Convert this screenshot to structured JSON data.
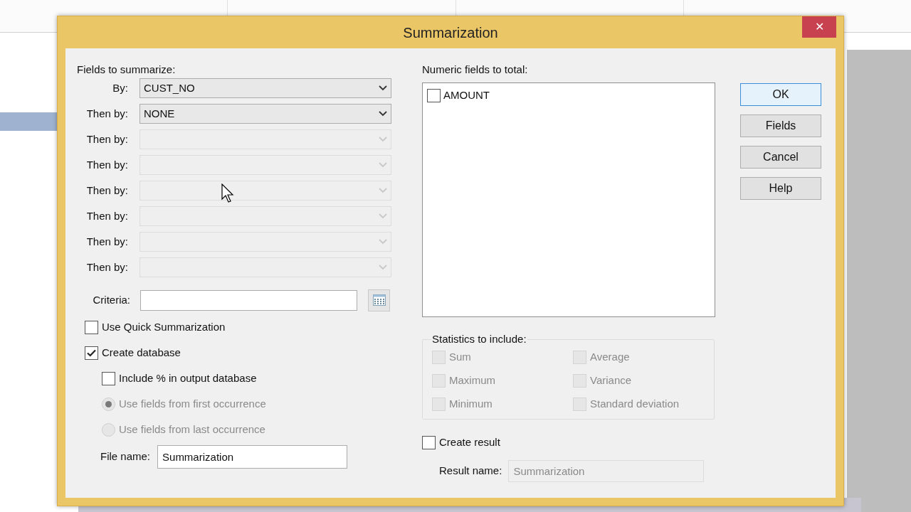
{
  "window": {
    "title": "Summarization",
    "close": "✕"
  },
  "fields_to_summarize": {
    "label": "Fields to summarize:",
    "rows": [
      {
        "label": "By:",
        "value": "CUST_NO",
        "disabled": false
      },
      {
        "label": "Then by:",
        "value": "NONE",
        "disabled": false
      },
      {
        "label": "Then by:",
        "disabled": true
      },
      {
        "label": "Then by:",
        "disabled": true
      },
      {
        "label": "Then by:",
        "disabled": true
      },
      {
        "label": "Then by:",
        "disabled": true
      },
      {
        "label": "Then by:",
        "disabled": true
      },
      {
        "label": "Then by:",
        "disabled": true
      }
    ]
  },
  "criteria": {
    "label": "Criteria:"
  },
  "options": [
    {
      "kind": "checkbox",
      "label": "Use Quick Summarization",
      "checked": false,
      "disabled": false
    },
    {
      "kind": "checkbox",
      "label": "Create database",
      "checked": true,
      "disabled": false,
      "children": [
        {
          "kind": "checkbox",
          "label": "Include % in output database",
          "checked": false,
          "disabled": false
        },
        {
          "kind": "radio",
          "label": "Use fields from first occurrence",
          "selected": true,
          "disabled": true
        },
        {
          "kind": "radio",
          "label": "Use fields from last occurrence",
          "selected": false,
          "disabled": true
        }
      ]
    }
  ],
  "file_name": {
    "label": "File name:",
    "value": "Summarization"
  },
  "numeric_fields": {
    "label": "Numeric fields to total:",
    "items": [
      {
        "label": "AMOUNT",
        "checked": false
      }
    ]
  },
  "statistics": {
    "label": "Statistics to include:",
    "disabled": true,
    "items": [
      {
        "label": "Sum",
        "checked": false
      },
      {
        "label": "Average",
        "checked": false
      },
      {
        "label": "Maximum",
        "checked": false
      },
      {
        "label": "Variance",
        "checked": false
      },
      {
        "label": "Minimum",
        "checked": false
      },
      {
        "label": "Standard deviation",
        "checked": false
      }
    ]
  },
  "create_result": {
    "label": "Create result",
    "checked": false
  },
  "result_name": {
    "label": "Result name:",
    "value": "Summarization",
    "disabled": true
  },
  "buttons": [
    {
      "label": "OK",
      "default": true
    },
    {
      "label": "Fields",
      "default": false
    },
    {
      "label": "Cancel",
      "default": false
    },
    {
      "label": "Help",
      "default": false
    }
  ]
}
